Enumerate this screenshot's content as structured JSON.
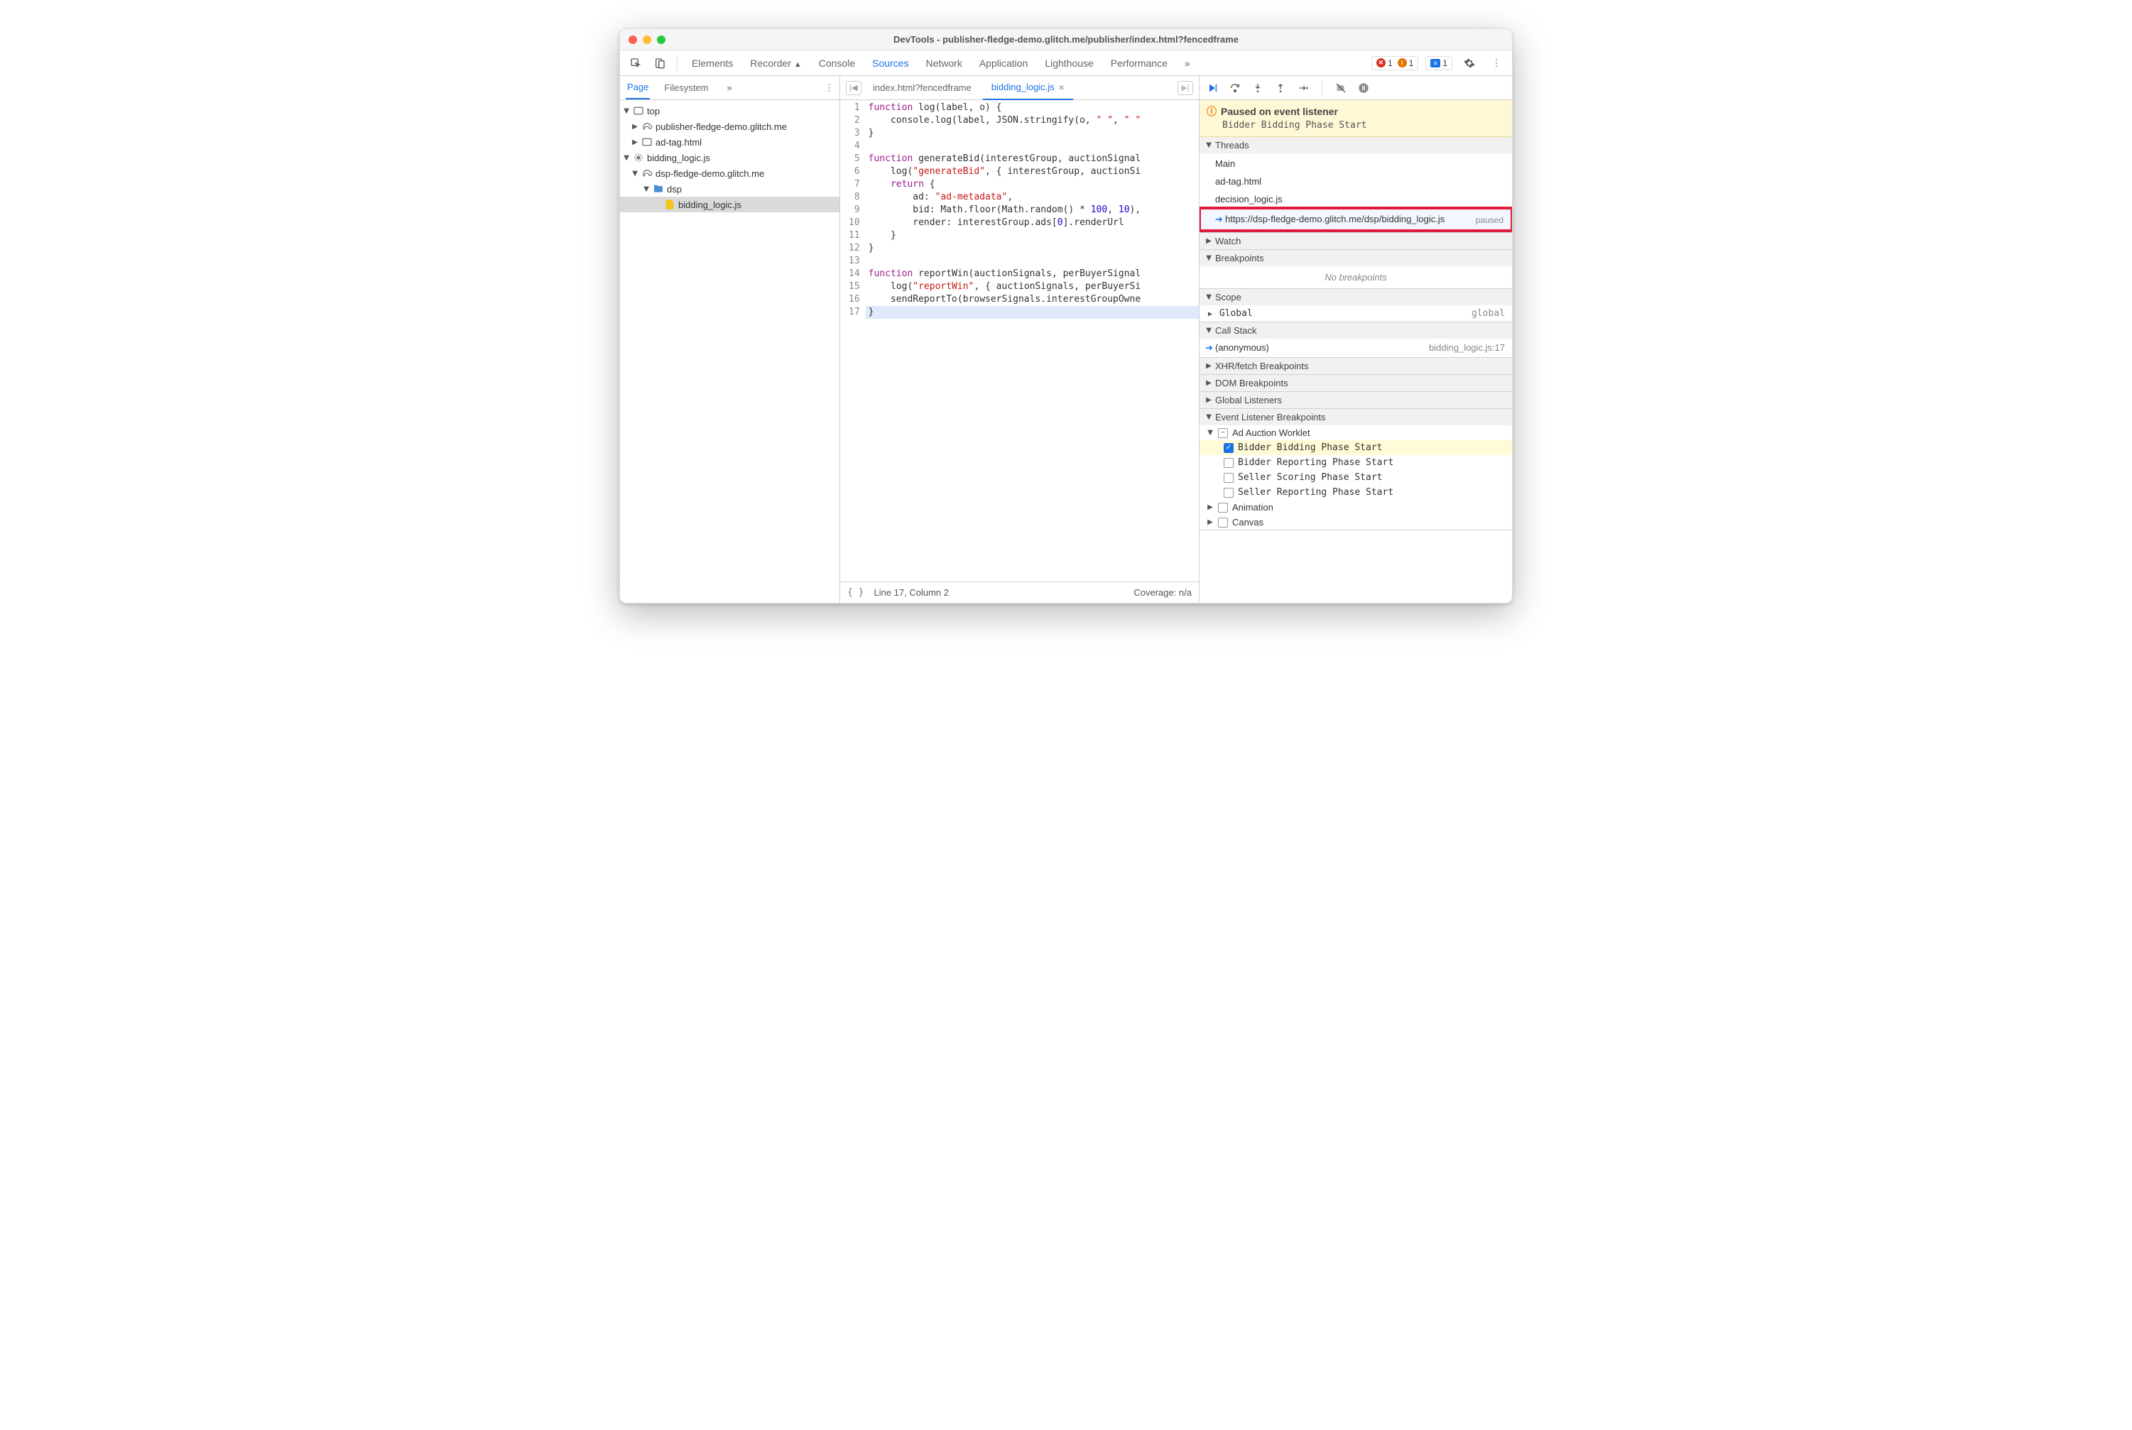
{
  "window": {
    "title": "DevTools - publisher-fledge-demo.glitch.me/publisher/index.html?fencedframe"
  },
  "main_tabs": [
    "Elements",
    "Recorder",
    "Console",
    "Sources",
    "Network",
    "Application",
    "Lighthouse",
    "Performance"
  ],
  "main_active": "Sources",
  "badges": {
    "errors": "1",
    "warnings": "1",
    "messages": "1"
  },
  "sidebar": {
    "tabs": [
      "Page",
      "Filesystem"
    ],
    "active": "Page",
    "tree": {
      "top": "top",
      "pub": "publisher-fledge-demo.glitch.me",
      "adtag": "ad-tag.html",
      "bidroot": "bidding_logic.js",
      "dspdomain": "dsp-fledge-demo.glitch.me",
      "dspfolder": "dsp",
      "bidfile": "bidding_logic.js"
    }
  },
  "editor": {
    "tabs": [
      {
        "label": "index.html?fencedframe"
      },
      {
        "label": "bidding_logic.js"
      }
    ],
    "active_idx": 1,
    "lines": 17,
    "code": [
      {
        "t": "function ",
        "c": "kw"
      },
      {
        "t": "log(label, o) {",
        "c": ""
      },
      "\n",
      {
        "t": "    console.log(label, JSON.stringify(o, ",
        "c": ""
      },
      {
        "t": "\" \"",
        "c": "str"
      },
      {
        "t": ", ",
        "c": ""
      },
      {
        "t": "\" \"",
        "c": "str"
      },
      "\n",
      {
        "t": "}",
        "c": ""
      },
      "\n",
      "\n",
      {
        "t": "function ",
        "c": "kw"
      },
      {
        "t": "generateBid(interestGroup, auctionSignal",
        "c": ""
      },
      "\n",
      {
        "t": "    log(",
        "c": ""
      },
      {
        "t": "\"generateBid\"",
        "c": "str"
      },
      {
        "t": ", { interestGroup, auctionSi",
        "c": ""
      },
      "\n",
      {
        "t": "    ",
        "c": ""
      },
      {
        "t": "return",
        "c": "kw"
      },
      {
        "t": " {",
        "c": ""
      },
      "\n",
      {
        "t": "        ad: ",
        "c": ""
      },
      {
        "t": "\"ad-metadata\"",
        "c": "str"
      },
      {
        "t": ",",
        "c": ""
      },
      "\n",
      {
        "t": "        bid: Math.floor(Math.random() * ",
        "c": ""
      },
      {
        "t": "100",
        "c": "num"
      },
      {
        "t": ", ",
        "c": ""
      },
      {
        "t": "10",
        "c": "num"
      },
      {
        "t": "),",
        "c": ""
      },
      "\n",
      {
        "t": "        render: interestGroup.ads[",
        "c": ""
      },
      {
        "t": "0",
        "c": "num"
      },
      {
        "t": "].renderUrl",
        "c": ""
      },
      "\n",
      {
        "t": "    }",
        "c": ""
      },
      "\n",
      {
        "t": "}",
        "c": ""
      },
      "\n",
      "\n",
      {
        "t": "function ",
        "c": "kw"
      },
      {
        "t": "reportWin(auctionSignals, perBuyerSignal",
        "c": ""
      },
      "\n",
      {
        "t": "    log(",
        "c": ""
      },
      {
        "t": "\"reportWin\"",
        "c": "str"
      },
      {
        "t": ", { auctionSignals, perBuyerSi",
        "c": ""
      },
      "\n",
      {
        "t": "    sendReportTo(browserSignals.interestGroupOwne",
        "c": ""
      },
      "\n",
      {
        "t": "}",
        "c": ""
      }
    ],
    "status": {
      "pos": "Line 17, Column 2",
      "coverage": "Coverage: n/a"
    }
  },
  "debug": {
    "paused_title": "Paused on event listener",
    "paused_sub": "Bidder Bidding Phase Start",
    "threads_label": "Threads",
    "threads": [
      "Main",
      "ad-tag.html",
      "decision_logic.js"
    ],
    "thread_active": "https://dsp-fledge-demo.glitch.me/dsp/bidding_logic.js",
    "thread_active_state": "paused",
    "watch": "Watch",
    "breakpoints": "Breakpoints",
    "no_bp": "No breakpoints",
    "scope": "Scope",
    "scope_row": {
      "l": "Global",
      "r": "global"
    },
    "callstack": "Call Stack",
    "cs_row": {
      "l": "(anonymous)",
      "r": "bidding_logic.js:17"
    },
    "xhr": "XHR/fetch Breakpoints",
    "dom": "DOM Breakpoints",
    "gl": "Global Listeners",
    "elb": "Event Listener Breakpoints",
    "adw": "Ad Auction Worklet",
    "evt": [
      {
        "label": "Bidder Bidding Phase Start",
        "checked": true,
        "hl": true
      },
      {
        "label": "Bidder Reporting Phase Start",
        "checked": false
      },
      {
        "label": "Seller Scoring Phase Start",
        "checked": false
      },
      {
        "label": "Seller Reporting Phase Start",
        "checked": false
      }
    ],
    "anim": "Animation",
    "canvas": "Canvas"
  }
}
